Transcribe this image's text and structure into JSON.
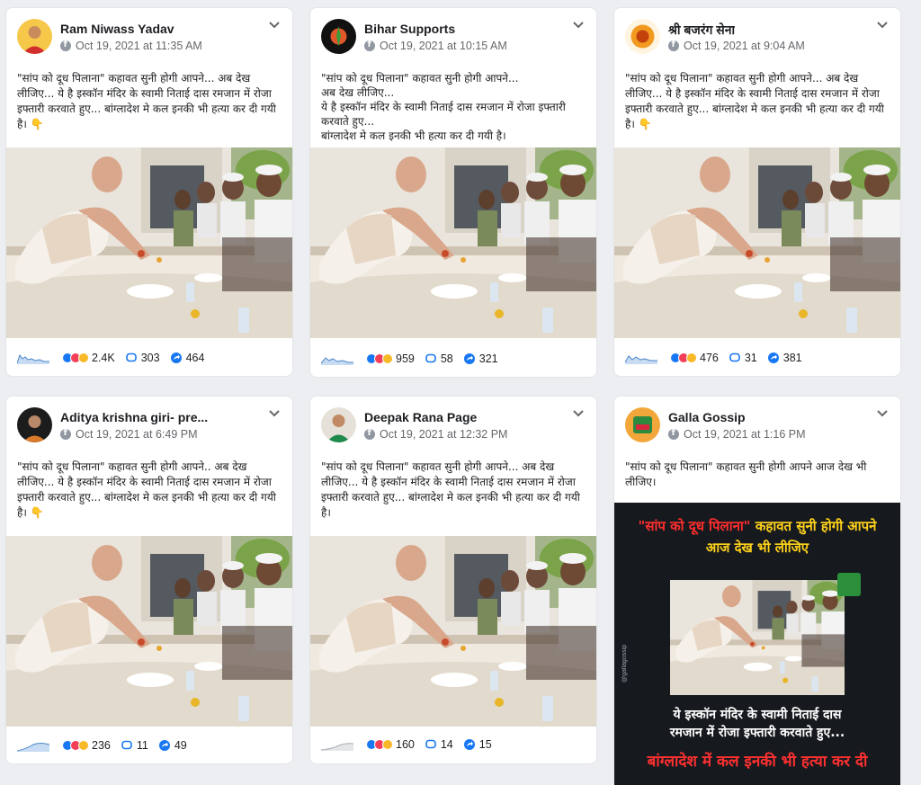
{
  "colors": {
    "page_bg": "#eceef1",
    "card_bg": "#ffffff",
    "meta_text": "#65676b",
    "like_blue": "#1877f2",
    "love_red": "#f33e58",
    "wow_yellow": "#f7b928",
    "poster_yellow": "#ffd21a",
    "poster_red": "#ff3030"
  },
  "icons": {
    "platform": "facebook-icon",
    "menu": "chevron-down-icon",
    "interactions": "sparkline-icon",
    "reactions": "reactions-icon",
    "comments": "comment-icon",
    "shares": "share-icon",
    "pointing": "pointing-down-emoji"
  },
  "posts": [
    {
      "author": "Ram Niwass Yadav",
      "date": "Oct 19, 2021 at 11:35 AM",
      "message": "\"सांप को दूध पिलाना\" कहावत सुनी होगी आपने... अब देख लीजिए... ये है इस्कॉन मंदिर के स्वामी निताई दास रमजान में रोजा इफ्तारी करवाते हुए... बांग्लादेश मे कल इनकी भी हत्या कर दी गयी है। 👇",
      "reactions": "2.4K",
      "comments": "303",
      "shares": "464"
    },
    {
      "author": "Bihar Supports",
      "date": "Oct 19, 2021 at 10:15 AM",
      "message": "\"सांप को दूध पिलाना\" कहावत सुनी होगी आपने...\nअब देख लीजिए...\nये है इस्कॉन मंदिर के स्वामी निताई दास रमजान में रोजा इफ्तारी करवाते हुए...\nबांग्लादेश मे कल इनकी भी हत्या कर दी गयी है।",
      "reactions": "959",
      "comments": "58",
      "shares": "321"
    },
    {
      "author": "श्री बजरंग सेना",
      "date": "Oct 19, 2021 at 9:04 AM",
      "message": "\"सांप को दूध पिलाना\" कहावत सुनी होगी आपने... अब देख लीजिए... ये है इस्कॉन मंदिर के स्वामी निताई दास रमजान में रोजा इफ्तारी करवाते हुए... बांग्लादेश मे कल इनकी भी हत्या कर दी गयी है। 👇",
      "reactions": "476",
      "comments": "31",
      "shares": "381"
    },
    {
      "author": "Aditya krishna giri- pre...",
      "date": "Oct 19, 2021 at 6:49 PM",
      "message": "\"सांप को दूध पिलाना\" कहावत सुनी होगी आपने.. अब देख लीजिए... ये है इस्कॉन मंदिर के स्वामी निताई दास रमजान में रोजा इफ्तारी करवाते हुए... बांग्लादेश मे कल इनकी भी हत्या कर दी गयी है। 👇",
      "reactions": "236",
      "comments": "11",
      "shares": "49"
    },
    {
      "author": "Deepak Rana Page",
      "date": "Oct 19, 2021 at 12:32 PM",
      "message": "\"सांप को दूध पिलाना\" कहावत सुनी होगी आपने... अब देख लीजिए... ये है इस्कॉन मंदिर के स्वामी निताई दास रमजान में रोजा इफ्तारी करवाते हुए... बांग्लादेश मे कल इनकी भी हत्या कर दी गयी है।",
      "reactions": "160",
      "comments": "14",
      "shares": "15"
    },
    {
      "author": "Galla Gossip",
      "date": "Oct 19, 2021 at 1:16 PM",
      "message": "\"सांप को दूध पिलाना\" कहावत सुनी होगी आपने आज देख भी लीजिए।",
      "poster": {
        "line1_quote": "\"सांप को दूध पिलाना\"",
        "line1_rest": " कहावत सुनी होगी आपने",
        "line2": "आज देख भी लीजिए",
        "mid1": "ये इस्कॉन मंदिर के स्वामी निताई दास",
        "mid2": "रमजान में रोजा इफ्तारी करवाते हुए...",
        "bottom": "बांग्लादेश में कल इनकी भी हत्या कर दी",
        "side": "@gallagossip"
      }
    }
  ]
}
